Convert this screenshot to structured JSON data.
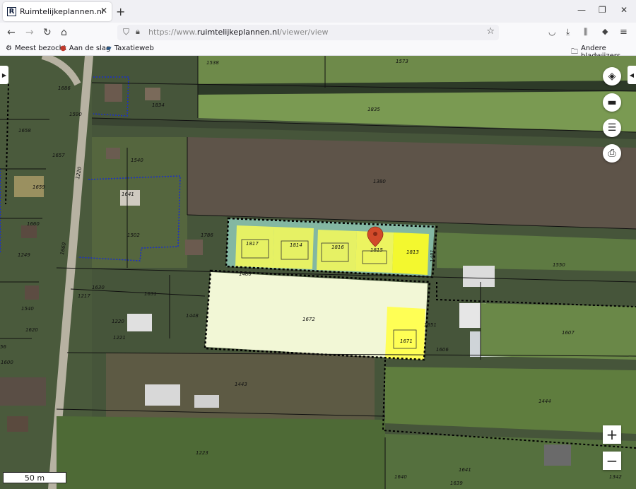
{
  "browser": {
    "tab_title": "Ruimtelijkeplannen.nl",
    "favicon_letter": "R",
    "url_prefix": "https://www.",
    "url_domain": "ruimtelijkeplannen.nl",
    "url_path": "/viewer/view"
  },
  "bookmarks": {
    "items": [
      "Meest bezocht",
      "Aan de slag",
      "Taxatieweb"
    ],
    "other": "Andere bladwijzers"
  },
  "map": {
    "scale_label": "50 m",
    "zoom_in": "+",
    "zoom_out": "−",
    "highlight_color": "#ffff55",
    "pale_color": "#f2f7d6",
    "parcel_labels": [
      "1538",
      "1573",
      "1686",
      "1834",
      "1835",
      "1590",
      "1658",
      "1657",
      "1540",
      "1659",
      "1380",
      "1641",
      "1660",
      "1502",
      "1786",
      "1817",
      "1814",
      "1816",
      "1815",
      "1813",
      "1481",
      "1550",
      "1249",
      "1660",
      "1480",
      "1630",
      "1631",
      "1217",
      "1540",
      "1448",
      "1220",
      "1672",
      "1651",
      "1620",
      "1221",
      "1671",
      "1606",
      "1607",
      "1443",
      "1444",
      "1223",
      "1640",
      "1641",
      "1639",
      "1342",
      "1600",
      "56",
      "1220"
    ]
  }
}
